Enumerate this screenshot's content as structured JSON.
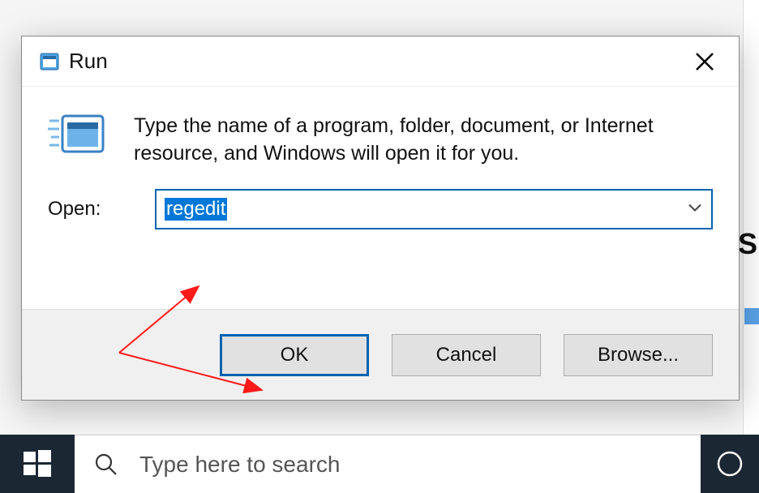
{
  "dialog": {
    "title": "Run",
    "instruction": "Type the name of a program, folder, document, or Internet resource, and Windows will open it for you.",
    "open_label": "Open:",
    "open_value": "regedit",
    "buttons": {
      "ok": "OK",
      "cancel": "Cancel",
      "browse": "Browse..."
    }
  },
  "taskbar": {
    "search_placeholder": "Type here to search"
  }
}
